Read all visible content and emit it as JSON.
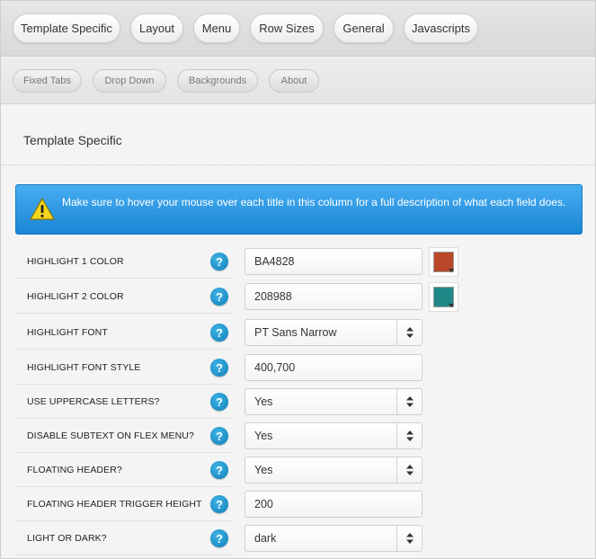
{
  "colors": {
    "notice_bg": "#2196e3",
    "help_icon": "#1a8fc9"
  },
  "main_tabs": [
    {
      "label": "Template Specific"
    },
    {
      "label": "Layout"
    },
    {
      "label": "Menu"
    },
    {
      "label": "Row Sizes"
    },
    {
      "label": "General"
    },
    {
      "label": "Javascripts"
    }
  ],
  "sub_tabs": [
    {
      "label": "Fixed Tabs"
    },
    {
      "label": "Drop Down"
    },
    {
      "label": "Backgrounds"
    },
    {
      "label": "About"
    }
  ],
  "section": {
    "title": "Template Specific"
  },
  "notice": {
    "icon": "warning-icon",
    "message": "Make sure to hover your mouse over each title in this column for a full description of what each field does."
  },
  "fields": [
    {
      "label": "HIGHLIGHT 1 COLOR",
      "type": "color",
      "value": "BA4828",
      "swatch": "#BA4828"
    },
    {
      "label": "HIGHLIGHT 2 COLOR",
      "type": "color",
      "value": "208988",
      "swatch": "#208988"
    },
    {
      "label": "HIGHLIGHT FONT",
      "type": "select",
      "value": "PT Sans Narrow"
    },
    {
      "label": "HIGHLIGHT FONT STYLE",
      "type": "text",
      "value": "400,700"
    },
    {
      "label": "USE UPPERCASE LETTERS?",
      "type": "select",
      "value": "Yes"
    },
    {
      "label": "DISABLE SUBTEXT ON FLEX MENU?",
      "type": "select",
      "value": "Yes"
    },
    {
      "label": "FLOATING HEADER?",
      "type": "select",
      "value": "Yes"
    },
    {
      "label": "FLOATING HEADER TRIGGER HEIGHT",
      "type": "text",
      "value": "200"
    },
    {
      "label": "LIGHT OR DARK?",
      "type": "select",
      "value": "dark"
    }
  ]
}
